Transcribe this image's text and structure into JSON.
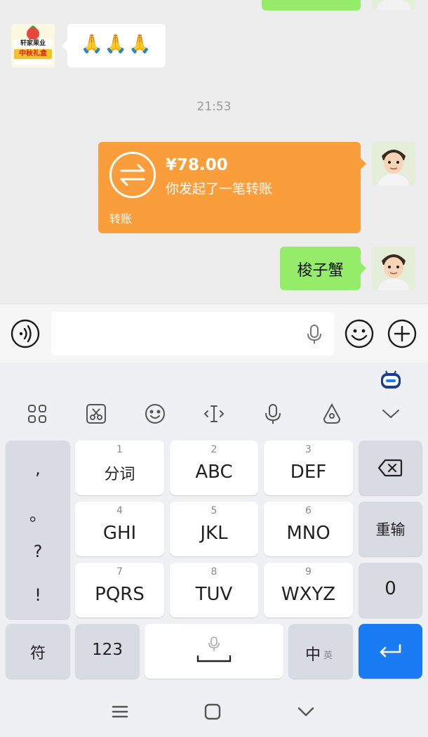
{
  "chat": {
    "emoji_message": "🙏🙏🙏",
    "timestamp": "21:53",
    "transfer": {
      "amount": "¥78.00",
      "description": "你发起了一笔转账",
      "label": "转账"
    },
    "text_message": "梭子蟹",
    "sender_avatar_text": "轩家果业",
    "sender_avatar_subtext": "中秋礼盒"
  },
  "input_bar": {
    "voice_icon": "voice-icon",
    "mic_icon": "mic-icon",
    "emoji_icon": "emoji-icon",
    "plus_icon": "plus-icon"
  },
  "keyboard": {
    "toolbar": [
      "apps-icon",
      "clipboard-icon",
      "smiley-icon",
      "cursor-icon",
      "mic-icon",
      "handwriting-icon",
      "collapse-icon"
    ],
    "punctuation": [
      ",",
      "。",
      "?",
      "!"
    ],
    "keys": [
      {
        "num": "1",
        "label": "分词"
      },
      {
        "num": "2",
        "label": "ABC"
      },
      {
        "num": "3",
        "label": "DEF"
      },
      {
        "num": "4",
        "label": "GHI"
      },
      {
        "num": "5",
        "label": "JKL"
      },
      {
        "num": "6",
        "label": "MNO"
      },
      {
        "num": "7",
        "label": "PQRS"
      },
      {
        "num": "8",
        "label": "TUV"
      },
      {
        "num": "9",
        "label": "WXYZ"
      }
    ],
    "reenter": "重输",
    "zero": "0",
    "symbol": "符",
    "numeric": "123",
    "lang_main": "中",
    "lang_sub": "英",
    "accent_color": "#1a7cf5"
  }
}
